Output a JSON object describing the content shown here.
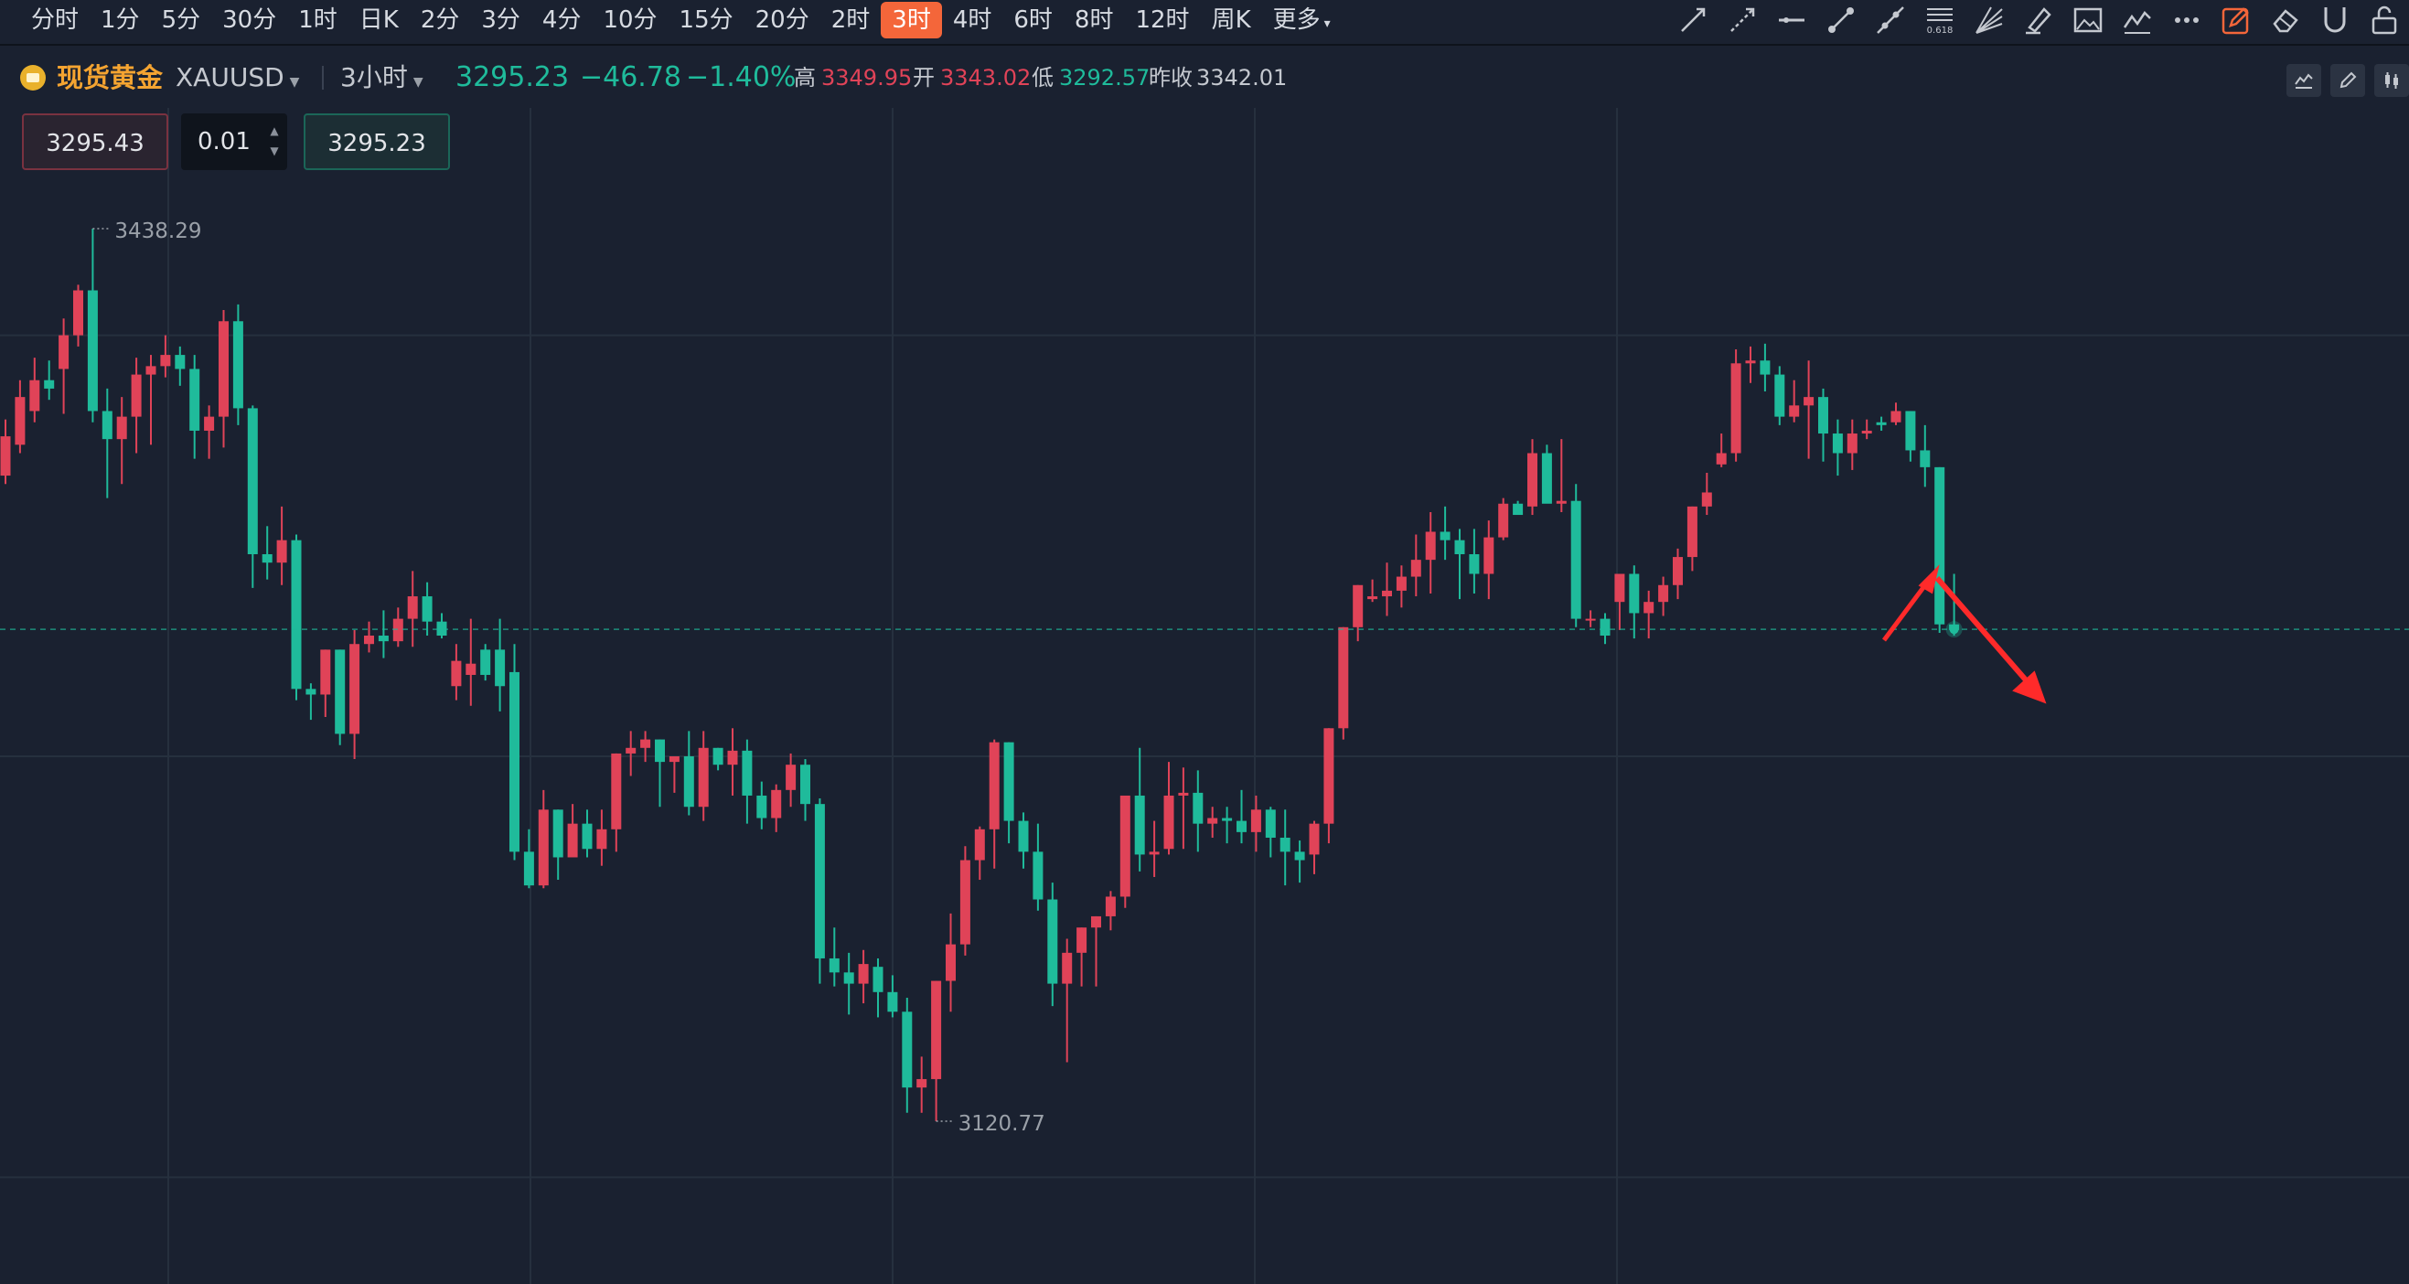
{
  "toolbar": {
    "timeframes": [
      "分时",
      "1分",
      "5分",
      "30分",
      "1时",
      "日K",
      "2分",
      "3分",
      "4分",
      "10分",
      "15分",
      "20分",
      "2时",
      "3时",
      "4时",
      "6时",
      "8时",
      "12时",
      "周K",
      "更多"
    ],
    "active": "3时",
    "tools": [
      "trend-line-icon",
      "ray-icon",
      "horizontal-line-icon",
      "segment-icon",
      "extended-line-icon",
      "fibonacci-icon",
      "gann-fan-icon",
      "brush-icon",
      "image-icon",
      "wave-icon",
      "more-icon",
      "draw-mode-icon",
      "eraser-icon",
      "magnet-icon",
      "lock-icon"
    ],
    "fib_label": "0.618"
  },
  "symbol": {
    "name": "现货黄金",
    "code": "XAUUSD",
    "period": "3小时",
    "price": "3295.23",
    "change": "−46.78",
    "change_pct": "−1.40%",
    "high_label": "高",
    "high": "3349.95",
    "open_label": "开",
    "open": "3343.02",
    "low_label": "低",
    "low": "3292.57",
    "prev_label": "昨收",
    "prev": "3342.01"
  },
  "trade": {
    "sell": "3295.43",
    "qty": "0.01",
    "buy": "3295.23"
  },
  "colors": {
    "up": "#e04358",
    "down": "#1fbb9b",
    "bg": "#1a2130",
    "grid": "#26303e",
    "annot": "#ff2a2a"
  },
  "chart_data": {
    "type": "candlestick",
    "price_range": [
      3062,
      3481
    ],
    "current_price": 3295.23,
    "max_label": "3438.29",
    "min_label": "3120.77",
    "candles": [
      [
        3350,
        3364,
        3347,
        3370
      ],
      [
        3361,
        3378,
        3358,
        3384
      ],
      [
        3373,
        3384,
        3369,
        3392
      ],
      [
        3384,
        3381,
        3377,
        3391
      ],
      [
        3388,
        3400,
        3372,
        3406
      ],
      [
        3400,
        3416,
        3396,
        3418
      ],
      [
        3416,
        3373,
        3369,
        3438
      ],
      [
        3373,
        3363,
        3342,
        3381
      ],
      [
        3363,
        3371,
        3347,
        3378
      ],
      [
        3371,
        3386,
        3358,
        3392
      ],
      [
        3386,
        3389,
        3361,
        3393
      ],
      [
        3389,
        3393,
        3385,
        3400
      ],
      [
        3393,
        3388,
        3382,
        3396
      ],
      [
        3388,
        3366,
        3356,
        3393
      ],
      [
        3366,
        3371,
        3356,
        3375
      ],
      [
        3371,
        3405,
        3360,
        3409
      ],
      [
        3405,
        3374,
        3368,
        3411
      ],
      [
        3374,
        3322,
        3310,
        3375
      ],
      [
        3322,
        3319,
        3313,
        3332
      ],
      [
        3319,
        3327,
        3311,
        3339
      ],
      [
        3327,
        3274,
        3270,
        3329
      ],
      [
        3274,
        3272,
        3263,
        3276
      ],
      [
        3272,
        3288,
        3264,
        3288
      ],
      [
        3288,
        3258,
        3254,
        3288
      ],
      [
        3258,
        3290,
        3249,
        3295
      ],
      [
        3290,
        3293,
        3287,
        3298
      ],
      [
        3293,
        3291,
        3285,
        3302
      ],
      [
        3291,
        3299,
        3289,
        3303
      ],
      [
        3299,
        3307,
        3289,
        3316
      ],
      [
        3307,
        3298,
        3293,
        3312
      ],
      [
        3298,
        3293,
        3292,
        3301
      ],
      [
        3275,
        3284,
        3270,
        3290
      ],
      [
        3279,
        3283,
        3268,
        3299
      ],
      [
        3288,
        3279,
        3277,
        3290
      ],
      [
        3288,
        3275,
        3266,
        3299
      ],
      [
        3280,
        3216,
        3213,
        3290
      ],
      [
        3216,
        3204,
        3203,
        3224
      ],
      [
        3204,
        3231,
        3203,
        3238
      ],
      [
        3231,
        3214,
        3206,
        3231
      ],
      [
        3214,
        3226,
        3219,
        3233
      ],
      [
        3226,
        3217,
        3214,
        3231
      ],
      [
        3217,
        3224,
        3211,
        3231
      ],
      [
        3224,
        3251,
        3216,
        3251
      ],
      [
        3251,
        3253,
        3243,
        3259
      ],
      [
        3253,
        3256,
        3248,
        3259
      ],
      [
        3256,
        3248,
        3232,
        3256
      ],
      [
        3248,
        3250,
        3237,
        3250
      ],
      [
        3250,
        3232,
        3229,
        3259
      ],
      [
        3232,
        3253,
        3227,
        3259
      ],
      [
        3253,
        3247,
        3245,
        3253
      ],
      [
        3247,
        3252,
        3236,
        3260
      ],
      [
        3252,
        3236,
        3226,
        3256
      ],
      [
        3236,
        3228,
        3224,
        3241
      ],
      [
        3228,
        3238,
        3223,
        3240
      ],
      [
        3238,
        3247,
        3232,
        3251
      ],
      [
        3247,
        3233,
        3227,
        3249
      ],
      [
        3233,
        3178,
        3169,
        3235
      ],
      [
        3178,
        3173,
        3168,
        3189
      ],
      [
        3173,
        3169,
        3158,
        3180
      ],
      [
        3169,
        3176,
        3162,
        3181
      ],
      [
        3175,
        3166,
        3157,
        3178
      ],
      [
        3166,
        3159,
        3157,
        3172
      ],
      [
        3159,
        3132,
        3123,
        3164
      ],
      [
        3132,
        3135,
        3123,
        3143
      ],
      [
        3135,
        3170,
        3120,
        3170
      ],
      [
        3170,
        3183,
        3159,
        3194
      ],
      [
        3183,
        3213,
        3179,
        3218
      ],
      [
        3213,
        3224,
        3206,
        3225
      ],
      [
        3224,
        3255,
        3210,
        3256
      ],
      [
        3255,
        3227,
        3219,
        3255
      ],
      [
        3227,
        3216,
        3210,
        3230
      ],
      [
        3216,
        3199,
        3195,
        3226
      ],
      [
        3199,
        3169,
        3161,
        3205
      ],
      [
        3169,
        3180,
        3141,
        3185
      ],
      [
        3180,
        3189,
        3168,
        3189
      ],
      [
        3189,
        3193,
        3168,
        3193
      ],
      [
        3193,
        3200,
        3188,
        3202
      ],
      [
        3200,
        3236,
        3196,
        3236
      ],
      [
        3236,
        3215,
        3209,
        3253
      ],
      [
        3215,
        3216,
        3207,
        3227
      ],
      [
        3217,
        3236,
        3215,
        3248
      ],
      [
        3236,
        3237,
        3217,
        3246
      ],
      [
        3237,
        3226,
        3216,
        3245
      ],
      [
        3226,
        3228,
        3221,
        3232
      ],
      [
        3228,
        3227,
        3219,
        3232
      ],
      [
        3227,
        3223,
        3219,
        3238
      ],
      [
        3223,
        3231,
        3216,
        3236
      ],
      [
        3231,
        3221,
        3214,
        3232
      ],
      [
        3221,
        3216,
        3204,
        3231
      ],
      [
        3216,
        3213,
        3205,
        3220
      ],
      [
        3215,
        3226,
        3208,
        3227
      ],
      [
        3226,
        3260,
        3219,
        3260
      ],
      [
        3260,
        3296,
        3256,
        3296
      ],
      [
        3296,
        3311,
        3291,
        3311
      ],
      [
        3306,
        3307,
        3305,
        3313
      ],
      [
        3307,
        3309,
        3300,
        3319
      ],
      [
        3309,
        3314,
        3303,
        3318
      ],
      [
        3314,
        3320,
        3307,
        3329
      ],
      [
        3320,
        3330,
        3308,
        3337
      ],
      [
        3330,
        3327,
        3320,
        3339
      ],
      [
        3327,
        3322,
        3306,
        3331
      ],
      [
        3322,
        3315,
        3308,
        3331
      ],
      [
        3315,
        3328,
        3306,
        3334
      ],
      [
        3328,
        3340,
        3327,
        3342
      ],
      [
        3340,
        3336,
        3338,
        3341
      ],
      [
        3339,
        3358,
        3336,
        3363
      ],
      [
        3358,
        3340,
        3345,
        3361
      ],
      [
        3340,
        3341,
        3337,
        3363
      ],
      [
        3341,
        3299,
        3296,
        3347
      ],
      [
        3299,
        3299,
        3296,
        3302
      ],
      [
        3299,
        3293,
        3290,
        3301
      ],
      [
        3305,
        3315,
        3295,
        3315
      ],
      [
        3315,
        3301,
        3292,
        3318
      ],
      [
        3301,
        3305,
        3292,
        3309
      ],
      [
        3305,
        3311,
        3300,
        3314
      ],
      [
        3311,
        3321,
        3306,
        3324
      ],
      [
        3321,
        3339,
        3316,
        3339
      ],
      [
        3339,
        3344,
        3336,
        3351
      ],
      [
        3354,
        3358,
        3353,
        3365
      ],
      [
        3358,
        3390,
        3355,
        3395
      ],
      [
        3390,
        3391,
        3383,
        3396
      ],
      [
        3391,
        3386,
        3380,
        3397
      ],
      [
        3386,
        3371,
        3368,
        3389
      ],
      [
        3371,
        3375,
        3369,
        3384
      ],
      [
        3375,
        3378,
        3356,
        3391
      ],
      [
        3378,
        3365,
        3355,
        3381
      ],
      [
        3365,
        3358,
        3350,
        3370
      ],
      [
        3358,
        3365,
        3352,
        3370
      ],
      [
        3365,
        3366,
        3363,
        3370
      ],
      [
        3369,
        3368,
        3366,
        3371
      ],
      [
        3369,
        3373,
        3368,
        3376
      ],
      [
        3373,
        3359,
        3355,
        3373
      ],
      [
        3359,
        3353,
        3346,
        3368
      ],
      [
        3353,
        3297,
        3294,
        3353
      ],
      [
        3297,
        3295,
        3293,
        3315
      ]
    ]
  }
}
